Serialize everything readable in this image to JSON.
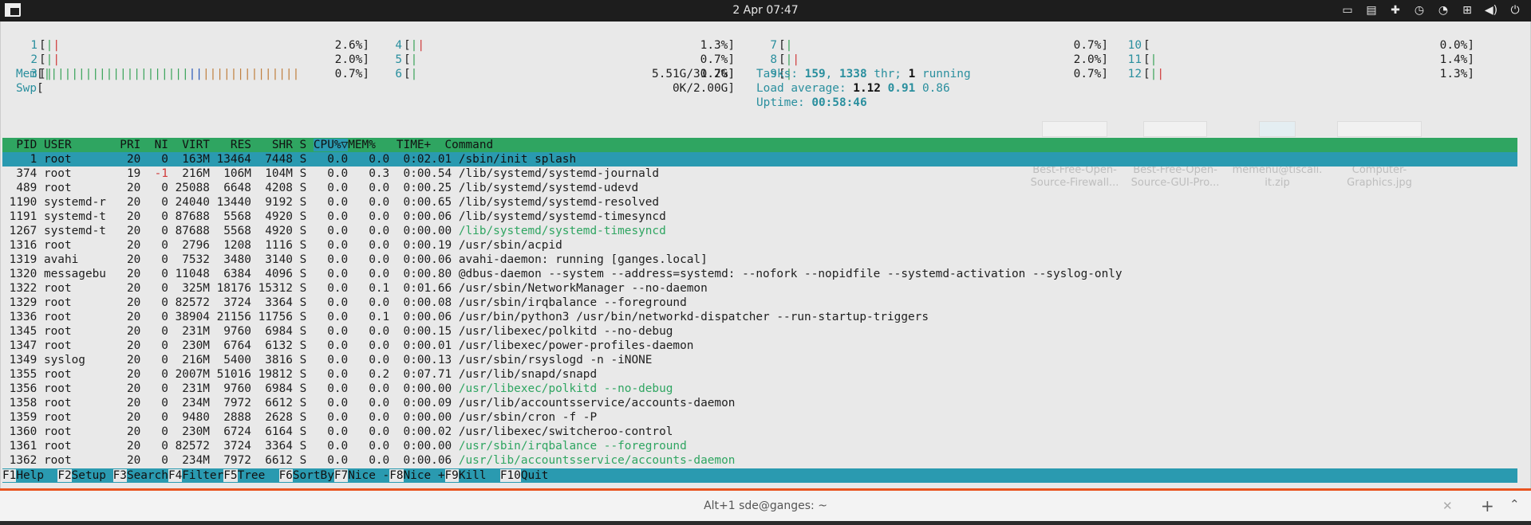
{
  "topbar": {
    "clock": "2 Apr  07:47"
  },
  "cpu_left": [
    {
      "n": "1",
      "bars": "||",
      "pct": "2.6%]"
    },
    {
      "n": "2",
      "bars": "||",
      "pct": "2.0%]"
    },
    {
      "n": "3",
      "bars": "|",
      "pct": "0.7%]"
    }
  ],
  "cpu_mid": [
    {
      "n": "4",
      "bars": "||",
      "pct": "1.3%]"
    },
    {
      "n": "5",
      "bars": "|",
      "pct": "0.7%]"
    },
    {
      "n": "6",
      "bars": "|",
      "pct": "0.7%]"
    }
  ],
  "cpu_right": [
    {
      "n": "7",
      "bars": "|",
      "pct": "0.7%]"
    },
    {
      "n": "8",
      "bars": "||",
      "pct": "2.0%]"
    },
    {
      "n": "9",
      "bars": "|",
      "pct": "0.7%]"
    }
  ],
  "cpu_far": [
    {
      "n": "10",
      "bars": "",
      "pct": "0.0%]"
    },
    {
      "n": "11",
      "bars": "|",
      "pct": "1.4%]"
    },
    {
      "n": "12",
      "bars": "||",
      "pct": "1.3%]"
    }
  ],
  "mem": {
    "label": "Mem",
    "value": "5.51G/31.2G]"
  },
  "swp": {
    "label": "Swp",
    "value": "0K/2.00G]"
  },
  "tasks": {
    "label": "Tasks: ",
    "count": "159",
    "sep": ", ",
    "thr": "1338",
    "thr_label": " thr; ",
    "running": "1",
    "running_label": " running"
  },
  "load": {
    "label": "Load average: ",
    "v1": "1.12",
    "v2": "0.91",
    "v3": "0.86"
  },
  "uptime": {
    "label": "Uptime: ",
    "value": "00:58:46"
  },
  "header": {
    "pre": "  PID USER       PRI  NI  VIRT   RES   SHR S ",
    "sort": "CPU%",
    "mid": "▽",
    "post": "MEM%   TIME+  Command"
  },
  "processes": [
    {
      "pid": "1",
      "user": "root",
      "pri": "20",
      "ni": "0",
      "virt": "163M",
      "res": "13464",
      "shr": "7448",
      "s": "S",
      "cpu": "0.0",
      "mem": "0.0",
      "time": "0:02.01",
      "cmd": "/sbin/init splash",
      "sel": true
    },
    {
      "pid": "374",
      "user": "root",
      "pri": "19",
      "ni": "-1",
      "virt": "216M",
      "res": "106M",
      "shr": "104M",
      "s": "S",
      "cpu": "0.0",
      "mem": "0.3",
      "time": "0:00.54",
      "cmd": "/lib/systemd/systemd-journald"
    },
    {
      "pid": "489",
      "user": "root",
      "pri": "20",
      "ni": "0",
      "virt": "25088",
      "res": "6648",
      "shr": "4208",
      "s": "S",
      "cpu": "0.0",
      "mem": "0.0",
      "time": "0:00.25",
      "cmd": "/lib/systemd/systemd-udevd"
    },
    {
      "pid": "1190",
      "user": "systemd-r",
      "pri": "20",
      "ni": "0",
      "virt": "24040",
      "res": "13440",
      "shr": "9192",
      "s": "S",
      "cpu": "0.0",
      "mem": "0.0",
      "time": "0:00.65",
      "cmd": "/lib/systemd/systemd-resolved"
    },
    {
      "pid": "1191",
      "user": "systemd-t",
      "pri": "20",
      "ni": "0",
      "virt": "87688",
      "res": "5568",
      "shr": "4920",
      "s": "S",
      "cpu": "0.0",
      "mem": "0.0",
      "time": "0:00.06",
      "cmd": "/lib/systemd/systemd-timesyncd"
    },
    {
      "pid": "1267",
      "user": "systemd-t",
      "pri": "20",
      "ni": "0",
      "virt": "87688",
      "res": "5568",
      "shr": "4920",
      "s": "S",
      "cpu": "0.0",
      "mem": "0.0",
      "time": "0:00.00",
      "cmd": "/lib/systemd/systemd-timesyncd",
      "thread": true
    },
    {
      "pid": "1316",
      "user": "root",
      "pri": "20",
      "ni": "0",
      "virt": "2796",
      "res": "1208",
      "shr": "1116",
      "s": "S",
      "cpu": "0.0",
      "mem": "0.0",
      "time": "0:00.19",
      "cmd": "/usr/sbin/acpid"
    },
    {
      "pid": "1319",
      "user": "avahi",
      "pri": "20",
      "ni": "0",
      "virt": "7532",
      "res": "3480",
      "shr": "3140",
      "s": "S",
      "cpu": "0.0",
      "mem": "0.0",
      "time": "0:00.06",
      "cmd": "avahi-daemon: running [ganges.local]"
    },
    {
      "pid": "1320",
      "user": "messagebu",
      "pri": "20",
      "ni": "0",
      "virt": "11048",
      "res": "6384",
      "shr": "4096",
      "s": "S",
      "cpu": "0.0",
      "mem": "0.0",
      "time": "0:00.80",
      "cmd": "@dbus-daemon --system --address=systemd: --nofork --nopidfile --systemd-activation --syslog-only"
    },
    {
      "pid": "1322",
      "user": "root",
      "pri": "20",
      "ni": "0",
      "virt": "325M",
      "res": "18176",
      "shr": "15312",
      "s": "S",
      "cpu": "0.0",
      "mem": "0.1",
      "time": "0:01.66",
      "cmd": "/usr/sbin/NetworkManager --no-daemon"
    },
    {
      "pid": "1329",
      "user": "root",
      "pri": "20",
      "ni": "0",
      "virt": "82572",
      "res": "3724",
      "shr": "3364",
      "s": "S",
      "cpu": "0.0",
      "mem": "0.0",
      "time": "0:00.08",
      "cmd": "/usr/sbin/irqbalance --foreground"
    },
    {
      "pid": "1336",
      "user": "root",
      "pri": "20",
      "ni": "0",
      "virt": "38904",
      "res": "21156",
      "shr": "11756",
      "s": "S",
      "cpu": "0.0",
      "mem": "0.1",
      "time": "0:00.06",
      "cmd": "/usr/bin/python3 /usr/bin/networkd-dispatcher --run-startup-triggers"
    },
    {
      "pid": "1345",
      "user": "root",
      "pri": "20",
      "ni": "0",
      "virt": "231M",
      "res": "9760",
      "shr": "6984",
      "s": "S",
      "cpu": "0.0",
      "mem": "0.0",
      "time": "0:00.15",
      "cmd": "/usr/libexec/polkitd --no-debug"
    },
    {
      "pid": "1347",
      "user": "root",
      "pri": "20",
      "ni": "0",
      "virt": "230M",
      "res": "6764",
      "shr": "6132",
      "s": "S",
      "cpu": "0.0",
      "mem": "0.0",
      "time": "0:00.01",
      "cmd": "/usr/libexec/power-profiles-daemon"
    },
    {
      "pid": "1349",
      "user": "syslog",
      "pri": "20",
      "ni": "0",
      "virt": "216M",
      "res": "5400",
      "shr": "3816",
      "s": "S",
      "cpu": "0.0",
      "mem": "0.0",
      "time": "0:00.13",
      "cmd": "/usr/sbin/rsyslogd -n -iNONE"
    },
    {
      "pid": "1355",
      "user": "root",
      "pri": "20",
      "ni": "0",
      "virt": "2007M",
      "res": "51016",
      "shr": "19812",
      "s": "S",
      "cpu": "0.0",
      "mem": "0.2",
      "time": "0:07.71",
      "cmd": "/usr/lib/snapd/snapd"
    },
    {
      "pid": "1356",
      "user": "root",
      "pri": "20",
      "ni": "0",
      "virt": "231M",
      "res": "9760",
      "shr": "6984",
      "s": "S",
      "cpu": "0.0",
      "mem": "0.0",
      "time": "0:00.00",
      "cmd": "/usr/libexec/polkitd --no-debug",
      "thread": true
    },
    {
      "pid": "1358",
      "user": "root",
      "pri": "20",
      "ni": "0",
      "virt": "234M",
      "res": "7972",
      "shr": "6612",
      "s": "S",
      "cpu": "0.0",
      "mem": "0.0",
      "time": "0:00.09",
      "cmd": "/usr/lib/accountsservice/accounts-daemon"
    },
    {
      "pid": "1359",
      "user": "root",
      "pri": "20",
      "ni": "0",
      "virt": "9480",
      "res": "2888",
      "shr": "2628",
      "s": "S",
      "cpu": "0.0",
      "mem": "0.0",
      "time": "0:00.00",
      "cmd": "/usr/sbin/cron -f -P"
    },
    {
      "pid": "1360",
      "user": "root",
      "pri": "20",
      "ni": "0",
      "virt": "230M",
      "res": "6724",
      "shr": "6164",
      "s": "S",
      "cpu": "0.0",
      "mem": "0.0",
      "time": "0:00.02",
      "cmd": "/usr/libexec/switcheroo-control"
    },
    {
      "pid": "1361",
      "user": "root",
      "pri": "20",
      "ni": "0",
      "virt": "82572",
      "res": "3724",
      "shr": "3364",
      "s": "S",
      "cpu": "0.0",
      "mem": "0.0",
      "time": "0:00.00",
      "cmd": "/usr/sbin/irqbalance --foreground",
      "thread": true
    },
    {
      "pid": "1362",
      "user": "root",
      "pri": "20",
      "ni": "0",
      "virt": "234M",
      "res": "7972",
      "shr": "6612",
      "s": "S",
      "cpu": "0.0",
      "mem": "0.0",
      "time": "0:00.06",
      "cmd": "/usr/lib/accountsservice/accounts-daemon",
      "thread": true
    }
  ],
  "fkeys": [
    {
      "k": "F1",
      "l": "Help  "
    },
    {
      "k": "F2",
      "l": "Setup "
    },
    {
      "k": "F3",
      "l": "Search"
    },
    {
      "k": "F4",
      "l": "Filter"
    },
    {
      "k": "F5",
      "l": "Tree  "
    },
    {
      "k": "F6",
      "l": "SortBy"
    },
    {
      "k": "F7",
      "l": "Nice -"
    },
    {
      "k": "F8",
      "l": "Nice +"
    },
    {
      "k": "F9",
      "l": "Kill  "
    },
    {
      "k": "F10",
      "l": "Quit"
    }
  ],
  "desktop_icons": [
    {
      "line1": "Best-Free-Open-",
      "line2": "Source-Firewall..."
    },
    {
      "line1": "Best-Free-Open-",
      "line2": "Source-GUI-Pro..."
    },
    {
      "line1": "memenu@tiscali.",
      "line2": "it.zip"
    },
    {
      "line1": "Computer-",
      "line2": "Graphics.jpg"
    }
  ],
  "window": {
    "title": "Alt+1  sde@ganges: ~",
    "close": "✕",
    "add": "+",
    "menu": "⌃"
  },
  "colors": {
    "accent": "#e95420",
    "header_green": "#2fa561",
    "select_cyan": "#2a9ab0"
  }
}
